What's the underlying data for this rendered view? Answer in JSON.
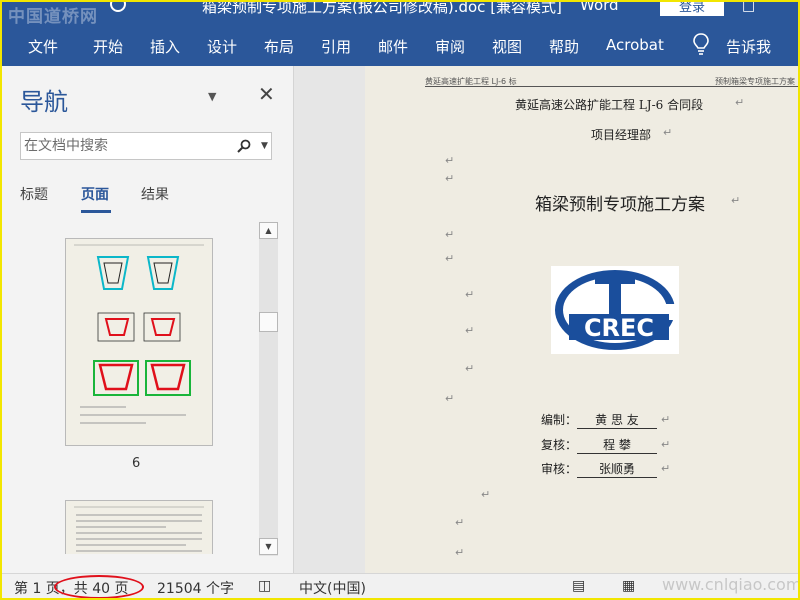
{
  "titlebar": {
    "watermark": "中国道桥网",
    "doc_title": "箱梁预制专项施工方案(报公司修改稿).doc [兼容模式]",
    "app": "Word",
    "login": "登录"
  },
  "ribbon": {
    "tabs": [
      "文件",
      "开始",
      "插入",
      "设计",
      "布局",
      "引用",
      "邮件",
      "审阅",
      "视图",
      "帮助",
      "Acrobat",
      "告诉我"
    ]
  },
  "nav": {
    "title": "导航",
    "search_placeholder": "在文档中搜索",
    "tabs": [
      "标题",
      "页面",
      "结果"
    ],
    "active_tab": "页面",
    "thumb_page_number": "6"
  },
  "document": {
    "header_left": "黄延高速扩能工程 LJ-6 标",
    "header_right": "预制箱梁专项施工方案",
    "line1": "黄延高速公路扩能工程 LJ-6 合同段",
    "line2": "项目经理部",
    "main_title": "箱梁预制专项施工方案",
    "logo_text": "CREC",
    "sign": [
      {
        "label": "编制：",
        "value": "黄 思 友"
      },
      {
        "label": "复核：",
        "value": "程  攀"
      },
      {
        "label": "审核：",
        "value": "张顺勇"
      }
    ]
  },
  "status": {
    "page": "第 1 页，共 40 页",
    "words": "21504 个字",
    "lang": "中文(中国)",
    "watermark": "www.cnlqiao.com"
  },
  "colors": {
    "ribbon": "#2b579a",
    "highlight": "#e0101b",
    "frame": "#f2e600"
  }
}
